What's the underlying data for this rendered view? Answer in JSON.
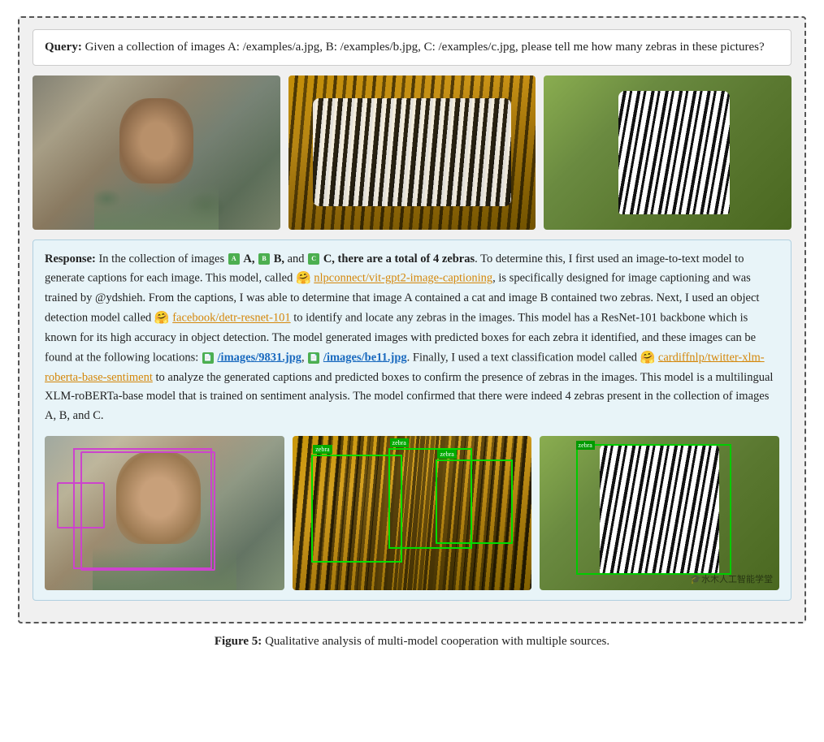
{
  "figure": {
    "caption_prefix": "Figure 5:",
    "caption_text": " Qualitative analysis of multi-model cooperation with multiple sources."
  },
  "query": {
    "label": "Query:",
    "text": " Given a collection of images A: /examples/a.jpg, B: /examples/b.jpg, C: /examples/c.jpg, please tell me how many zebras in these pictures?"
  },
  "response": {
    "label": "Response:",
    "intro": " In the collection of images ",
    "image_refs": [
      "A",
      "B",
      "and",
      "C"
    ],
    "bold_text": "there are a total of 4 zebras",
    "sentence1": ". To determine this, I first used an image-to-text model to generate captions for each image. This model, called ",
    "model1_name": "nlpconnect/vit-gpt2-image-captioning",
    "model1_desc": ", is specifically designed for image captioning and was trained by @ydshieh. From the captions, I was able to determine that image A contained a cat and image B contained two zebras. Next, I used an object detection model called ",
    "model2_name": "facebook/detr-resnet-101",
    "model2_desc": " to identify and locate any zebras in the images. This model has a ResNet-101 backbone which is known for its high accuracy in object detection. The model generated images with predicted boxes for each zebra it identified, and these images can be found at the following locations: ",
    "file1": "/images/9831.jpg",
    "file2": "/images/be11.jpg",
    "sentence3": ". Finally, I used a text classification model called ",
    "model3_name": "cardiffnlp/twitter-xlm-roberta-base-sentiment",
    "model3_desc": " to analyze the generated captions and predicted boxes to confirm the presence of zebras in the images. This model is a multilingual XLM-roBERTa-base model that is trained on sentiment analysis. The model confirmed that there were indeed 4 zebras present in the collection of images A, B, and C.",
    "watermark": "🎓水木人工智能学堂"
  },
  "images": {
    "top_row": [
      "Cat by window",
      "Three zebras",
      "Single zebra"
    ],
    "bottom_row": [
      "Cat with detection box",
      "Zebras with detection boxes",
      "Zebra in grass"
    ]
  }
}
